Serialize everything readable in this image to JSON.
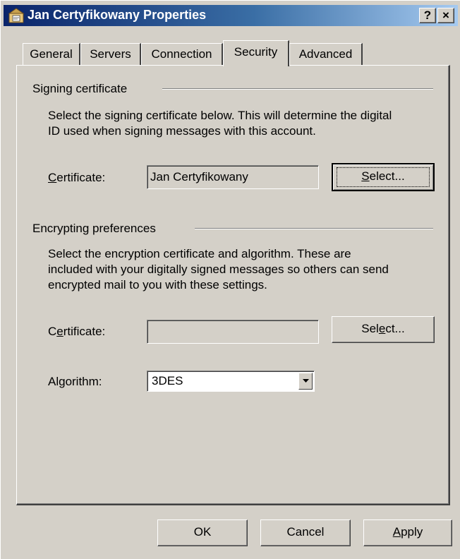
{
  "window": {
    "title": "Jan Certyfikowany Properties",
    "help_button": "?",
    "close_button": "×"
  },
  "tabs": [
    {
      "label": "General",
      "active": false
    },
    {
      "label": "Servers",
      "active": false
    },
    {
      "label": "Connection",
      "active": false
    },
    {
      "label": "Security",
      "active": true
    },
    {
      "label": "Advanced",
      "active": false
    }
  ],
  "signing": {
    "group_label": "Signing certificate",
    "description_line1": "Select the signing certificate below. This will determine the digital",
    "description_line2": "ID used when signing messages with this account.",
    "certificate_label_accesskey": "C",
    "certificate_label_rest": "ertificate:",
    "certificate_value": "Jan Certyfikowany",
    "select_accesskey": "S",
    "select_rest": "elect..."
  },
  "encrypting": {
    "group_label": "Encrypting preferences",
    "description_line1": "Select the encryption certificate and algorithm. These are",
    "description_line2": "included with your digitally signed messages so others can send",
    "description_line3": "encrypted mail to you with these settings.",
    "certificate_label_pre": "C",
    "certificate_label_accesskey": "e",
    "certificate_label_rest": "rtificate:",
    "certificate_value": "",
    "select_pre": "Sel",
    "select_accesskey": "e",
    "select_rest": "ct...",
    "algorithm_label": "Algorithm:",
    "algorithm_value": "3DES"
  },
  "footer": {
    "ok": "OK",
    "cancel": "Cancel",
    "apply_accesskey": "A",
    "apply_rest": "pply"
  },
  "icons": {
    "title": "account-properties-icon",
    "dropdown": "chevron-down-icon"
  }
}
